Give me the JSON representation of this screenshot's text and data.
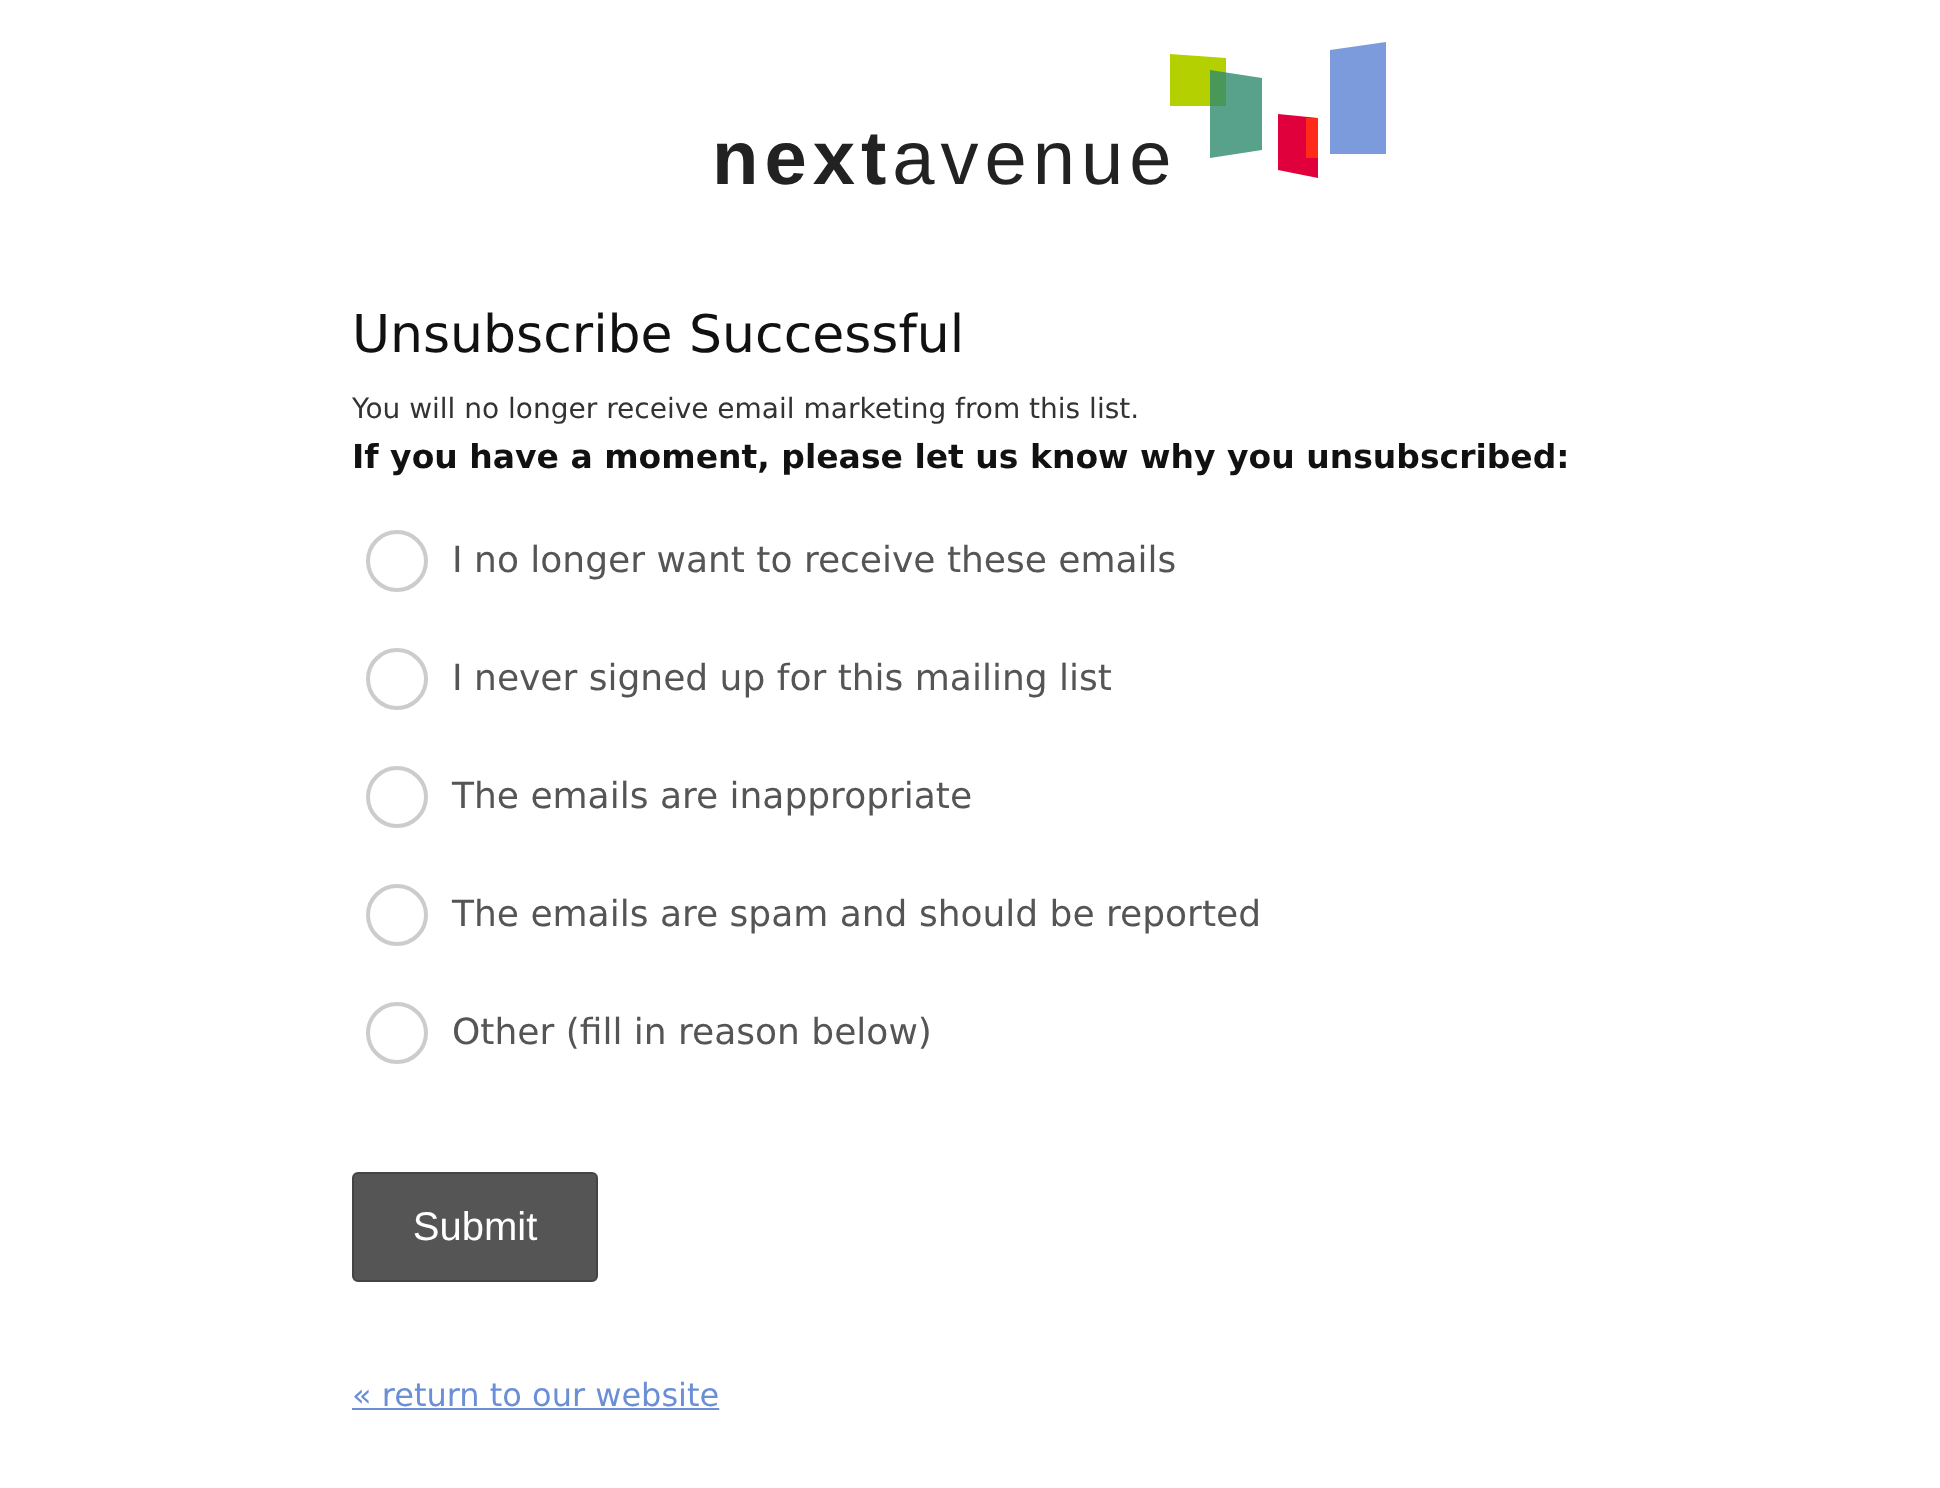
{
  "logo": {
    "wordmark": "**next**avenue"
  },
  "title": "Unsubscribe Successful",
  "message": "You will no longer receive email marketing from this list.",
  "question": "If you have a moment, please let us know why you unsubscribed:",
  "reasons": [
    {
      "label": "I no longer want to receive these emails",
      "selected": false
    },
    {
      "label": "I never signed up for this mailing list",
      "selected": false
    },
    {
      "label": "The emails are inappropriate",
      "selected": false
    },
    {
      "label": "The emails are spam and should be reported",
      "selected": false
    },
    {
      "label": "Other (fill in reason below)",
      "selected": false
    }
  ],
  "submit_button": "Submit",
  "return_link": "« return to our website"
}
